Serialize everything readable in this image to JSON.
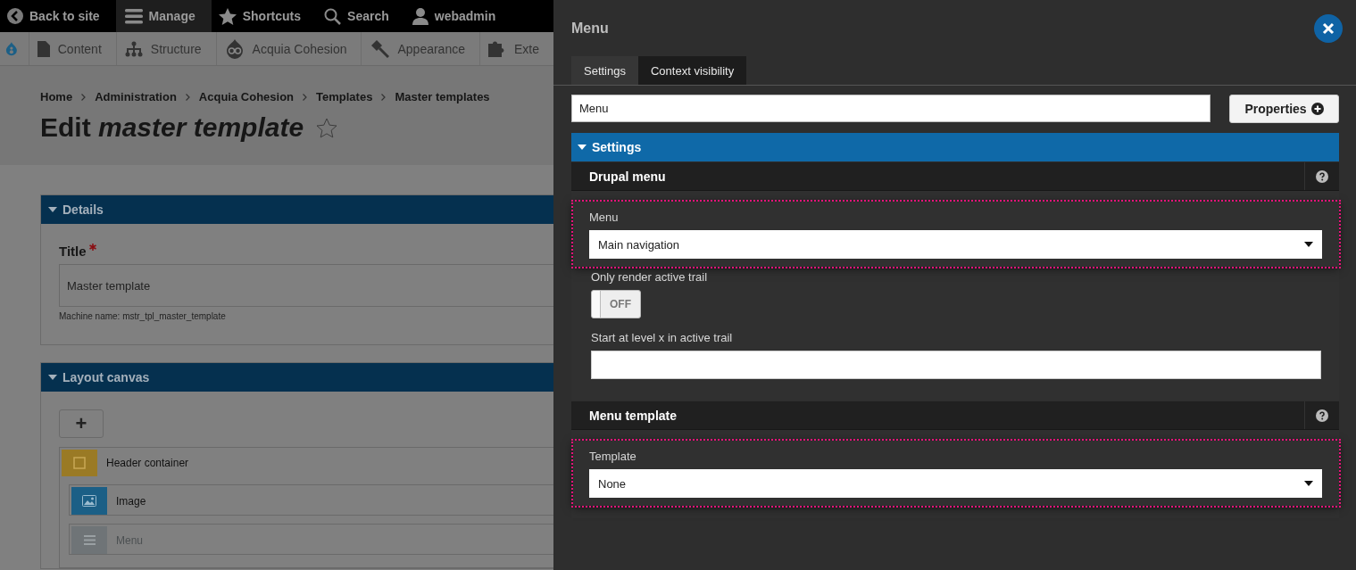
{
  "toolbar": {
    "items": [
      {
        "label": "Back to site",
        "selected": false
      },
      {
        "label": "Manage",
        "selected": true
      },
      {
        "label": "Shortcuts",
        "selected": false
      },
      {
        "label": "Search",
        "selected": false
      },
      {
        "label": "webadmin",
        "selected": false
      }
    ]
  },
  "admin_menu": {
    "items": [
      "Content",
      "Structure",
      "Acquia Cohesion",
      "Appearance",
      "Exte"
    ]
  },
  "breadcrumb": [
    "Home",
    "Administration",
    "Acquia Cohesion",
    "Templates",
    "Master templates"
  ],
  "page_title": "Edit *master template*",
  "details": {
    "title": "Details",
    "expanded": true,
    "field_label": "Title",
    "required": true,
    "value": "Master template",
    "help": "Machine name: mstr_tpl_master_template"
  },
  "layout_canvas": {
    "title": "Layout canvas",
    "expanded": true,
    "add_button": "+",
    "elements": [
      {
        "label": "Header container",
        "kind": "container",
        "color": "#9a7a25",
        "editing": false,
        "children": [
          {
            "label": "Image",
            "kind": "image",
            "color": "#1b5f86",
            "editing": false
          },
          {
            "label": "Menu",
            "kind": "menu",
            "color": "#6f7477",
            "editing": true
          }
        ]
      }
    ]
  },
  "panel": {
    "title": "Menu",
    "tabs": [
      {
        "label": "Settings",
        "selected": true
      },
      {
        "label": "Context visibility",
        "selected": false
      }
    ],
    "name_value": "Menu",
    "properties_button": "Properties",
    "section": {
      "title": "Settings",
      "expanded": true,
      "groups": [
        {
          "title": "Drupal menu",
          "fields": [
            {
              "kind": "select",
              "label": "Menu",
              "value": "Main navigation",
              "highlighted": true
            },
            {
              "kind": "toggle",
              "label": "Only render active trail",
              "on": false,
              "text": "OFF",
              "highlighted": false
            },
            {
              "kind": "text",
              "label": "Start at level x in active trail",
              "highlighted": false
            }
          ]
        },
        {
          "title": "Menu template",
          "fields": [
            {
              "kind": "select",
              "label": "Template",
              "value": "None",
              "highlighted": true
            }
          ]
        }
      ]
    }
  }
}
